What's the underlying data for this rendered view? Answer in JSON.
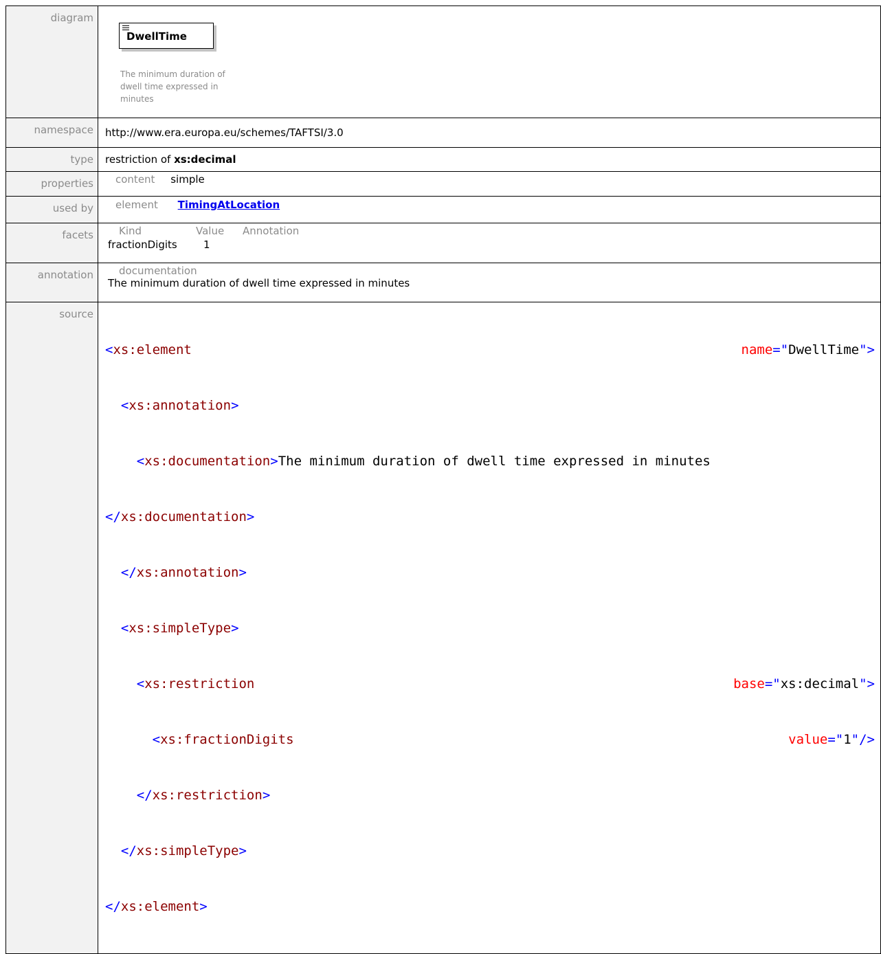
{
  "rows": {
    "diagram": {
      "label": "diagram",
      "element_name": "DwellTime",
      "description": "The minimum duration of dwell time expressed in minutes"
    },
    "namespace": {
      "label": "namespace",
      "value": "http://www.era.europa.eu/schemes/TAFTSI/3.0"
    },
    "type": {
      "label": "type",
      "prefix": "restriction of ",
      "base": "xs:decimal"
    },
    "properties": {
      "label": "properties",
      "key": "content",
      "value": "simple"
    },
    "used_by": {
      "label": "used by",
      "key": "element",
      "link": "TimingAtLocation"
    },
    "facets": {
      "label": "facets",
      "headers": [
        "Kind",
        "Value",
        "Annotation"
      ],
      "rows": [
        {
          "kind": "fractionDigits",
          "value": "1",
          "annotation": ""
        }
      ]
    },
    "annotation": {
      "label": "annotation",
      "key": "documentation",
      "value": "The minimum duration of dwell time expressed in minutes"
    },
    "source": {
      "label": "source",
      "element_tag": "xs:element",
      "name_attr": "name",
      "name_value": "DwellTime",
      "annotation_tag": "xs:annotation",
      "documentation_tag": "xs:documentation",
      "documentation_text": "The minimum duration of dwell time expressed in minutes",
      "simple_type_tag": "xs:simpleType",
      "restriction_tag": "xs:restriction",
      "base_attr": "base",
      "base_value": "xs:decimal",
      "fraction_tag": "xs:fractionDigits",
      "value_attr": "value",
      "value_value": "1"
    }
  },
  "colors": {
    "label_bg": "#f2f2f2",
    "label_text": "#8b8b8b",
    "xml_tag": "#8b0000",
    "xml_bracket": "#0000ff",
    "xml_attr": "#ff0000",
    "link": "#0000ee"
  },
  "icons": {
    "element_icon": "element-lines-icon"
  }
}
